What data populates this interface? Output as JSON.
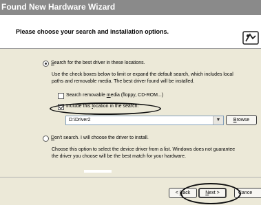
{
  "window": {
    "title": "Found New Hardware Wizard"
  },
  "header": {
    "heading": "Please choose your search and installation options."
  },
  "options": {
    "search": {
      "label_prefix": "",
      "label_ul": "S",
      "label_rest": "earch for the best driver in these locations.",
      "description_line1": "Use the check boxes below to limit or expand the default search, which includes local",
      "description_line2": "paths and removable media. The best driver found will be installed."
    },
    "removable": {
      "label_prefix": "Search removable ",
      "label_ul": "m",
      "label_rest": "edia (floppy, CD-ROM...)"
    },
    "include_location": {
      "label_prefix": "Include this ",
      "label_ul": "l",
      "label_rest": "ocation in the search:"
    },
    "path": {
      "value": "D:\\Driver2"
    },
    "browse": {
      "label_prefix": "",
      "label_ul": "B",
      "label_rest": "rowse"
    },
    "dont_search": {
      "label_prefix": "",
      "label_ul": "D",
      "label_rest": "on't search. I will choose the driver to install.",
      "description_line1": "Choose this option to select the device driver from a list.  Windows does not guarantee",
      "description_line2": "the driver you choose will be the best match for your hardware."
    }
  },
  "buttons": {
    "back": {
      "label_prefix": "< ",
      "label_ul": "B",
      "label_rest": "ack"
    },
    "next": {
      "label_prefix": "",
      "label_ul": "N",
      "label_rest": "ext >"
    },
    "cancel": {
      "label": "Cance"
    }
  },
  "icons": {
    "header": "hardware-wizard-icon"
  }
}
